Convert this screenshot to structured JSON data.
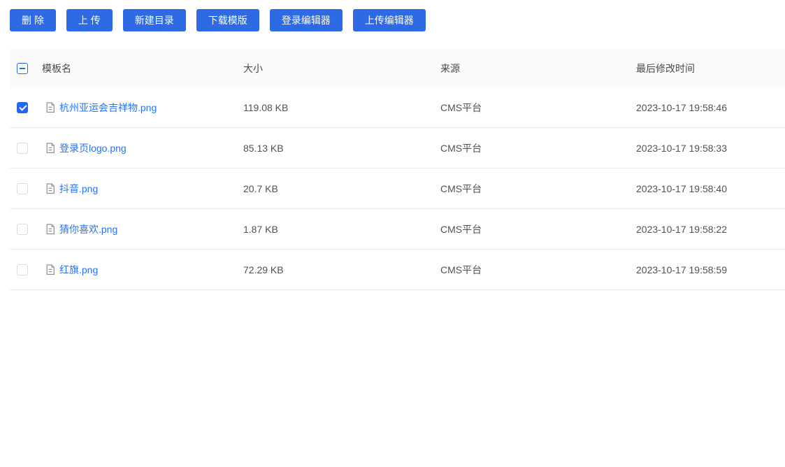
{
  "colors": {
    "button_bg": "#2d6ae3",
    "button_text": "#ffffff",
    "link": "#2673f4",
    "checkbox_accent": "#2468f2",
    "header_bg": "#fafafa",
    "row_border": "#ebebeb",
    "header_text": "#4a4a4a",
    "cell_text": "#515151",
    "file_icon_gray": "#8f8f8f"
  },
  "toolbar": {
    "buttons": [
      {
        "name": "delete-button",
        "label": "删 除"
      },
      {
        "name": "upload-button",
        "label": "上 传"
      },
      {
        "name": "new-directory-button",
        "label": "新建目录"
      },
      {
        "name": "download-template-button",
        "label": "下载模版"
      },
      {
        "name": "login-editor-button",
        "label": "登录编辑器"
      },
      {
        "name": "upload-editor-button",
        "label": "上传编辑器"
      }
    ]
  },
  "table": {
    "select_all_state": "indeterminate",
    "columns": {
      "name": "模板名",
      "size": "大小",
      "source": "来源",
      "modified": "最后修改时间"
    },
    "rows": [
      {
        "checked": true,
        "name": "杭州亚运会吉祥物.png",
        "size": "119.08 KB",
        "source": "CMS平台",
        "modified": "2023-10-17 19:58:46"
      },
      {
        "checked": false,
        "name": "登录页logo.png",
        "size": "85.13 KB",
        "source": "CMS平台",
        "modified": "2023-10-17 19:58:33"
      },
      {
        "checked": false,
        "name": "抖音.png",
        "size": "20.7 KB",
        "source": "CMS平台",
        "modified": "2023-10-17 19:58:40"
      },
      {
        "checked": false,
        "name": "猜你喜欢.png",
        "size": "1.87 KB",
        "source": "CMS平台",
        "modified": "2023-10-17 19:58:22"
      },
      {
        "checked": false,
        "name": "红旗.png",
        "size": "72.29 KB",
        "source": "CMS平台",
        "modified": "2023-10-17 19:58:59"
      }
    ]
  }
}
